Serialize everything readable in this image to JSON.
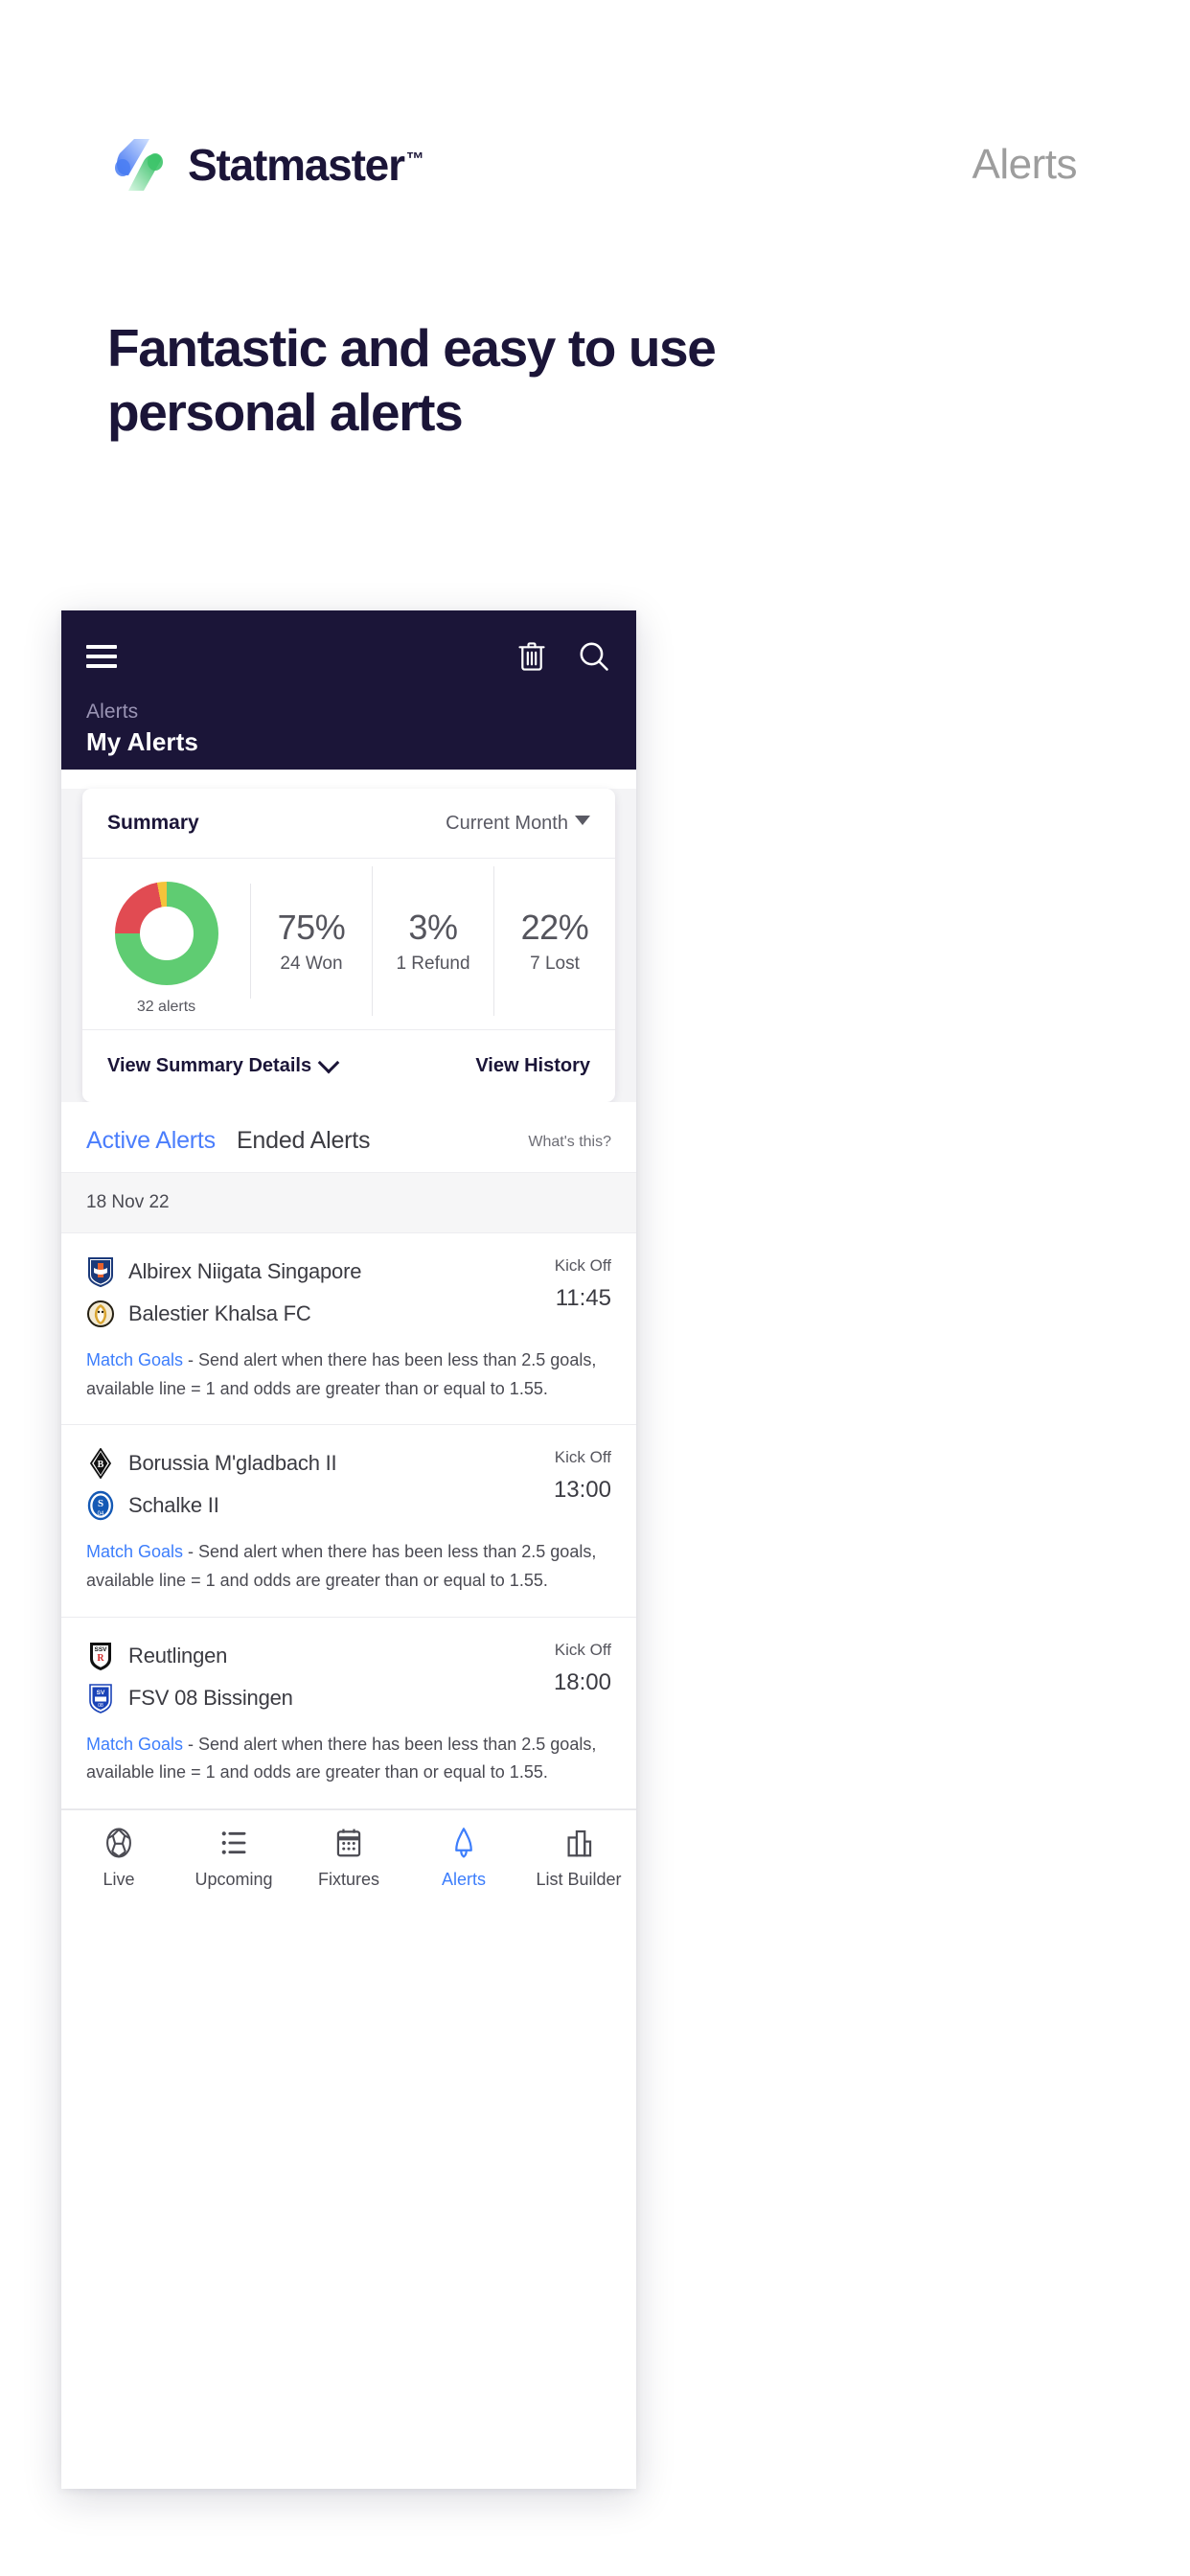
{
  "brand": {
    "name": "Statmaster",
    "tm": "™",
    "logo_icon": "statmaster-slash-logo",
    "right_label": "Alerts"
  },
  "headline": "Fantastic and easy to use personal alerts",
  "app": {
    "header": {
      "menu_icon": "hamburger-menu-icon",
      "delete_icon": "trash-icon",
      "search_icon": "search-icon",
      "breadcrumb": "Alerts",
      "title": "My Alerts"
    },
    "summary": {
      "title": "Summary",
      "period": "Current Month",
      "period_caret_icon": "caret-down-icon",
      "donut_caption": "32 alerts",
      "stats": [
        {
          "value": "75%",
          "label": "24 Won"
        },
        {
          "value": "3%",
          "label": "1 Refund"
        },
        {
          "value": "22%",
          "label": "7 Lost"
        }
      ],
      "view_details": "View Summary Details",
      "view_details_icon": "chevron-down-icon",
      "view_history": "View History"
    },
    "tabs": [
      {
        "label": "Active Alerts",
        "active": true
      },
      {
        "label": "Ended Alerts",
        "active": false
      }
    ],
    "whats_this": "What's this?",
    "date_group": "18 Nov 22",
    "alerts": [
      {
        "home": "Albirex Niigata Singapore",
        "away": "Balestier Khalsa FC",
        "home_crest_icon": "albirex-niigata-crest-icon",
        "away_crest_icon": "balestier-khalsa-crest-icon",
        "kick_label": "Kick Off",
        "kick_time": "11:45",
        "market": "Match Goals",
        "desc": " - Send alert when there has been less than 2.5 goals, available line = 1 and odds are greater than or equal to 1.55."
      },
      {
        "home": "Borussia M'gladbach II",
        "away": "Schalke II",
        "home_crest_icon": "borussia-monchengladbach-crest-icon",
        "away_crest_icon": "schalke-crest-icon",
        "kick_label": "Kick Off",
        "kick_time": "13:00",
        "market": "Match Goals",
        "desc": " - Send alert when there has been less than 2.5 goals, available line = 1 and odds are greater than or equal to 1.55."
      },
      {
        "home": "Reutlingen",
        "away": "FSV 08 Bissingen",
        "home_crest_icon": "reutlingen-crest-icon",
        "away_crest_icon": "fsv-bissingen-crest-icon",
        "kick_label": "Kick Off",
        "kick_time": "18:00",
        "market": "Match Goals",
        "desc": " - Send alert when there has been less than 2.5 goals, available line = 1 and odds are greater than or equal to 1.55."
      }
    ],
    "bottom_nav": [
      {
        "label": "Live",
        "icon": "football-icon",
        "active": false
      },
      {
        "label": "Upcoming",
        "icon": "list-icon",
        "active": false
      },
      {
        "label": "Fixtures",
        "icon": "calendar-icon",
        "active": false
      },
      {
        "label": "Alerts",
        "icon": "bell-icon",
        "active": true
      },
      {
        "label": "List Builder",
        "icon": "bar-chart-icon",
        "active": false
      }
    ]
  },
  "chart_data": {
    "type": "pie",
    "title": "Summary",
    "categories": [
      "Won",
      "Lost",
      "Refund"
    ],
    "values": [
      75,
      22,
      3
    ],
    "counts": [
      24,
      7,
      1
    ],
    "total": 32,
    "total_label": "32 alerts",
    "colors": [
      "#5fcc72",
      "#e14b52",
      "#f5c33b"
    ],
    "legend": "right",
    "grid": false
  },
  "colors": {
    "navy": "#1b1538",
    "accent_blue": "#3d7efc",
    "tab_blue": "#4a7dfc",
    "green": "#5fcc72",
    "red": "#e14b52",
    "yellow": "#f5c33b",
    "grey_text": "#55555d"
  }
}
